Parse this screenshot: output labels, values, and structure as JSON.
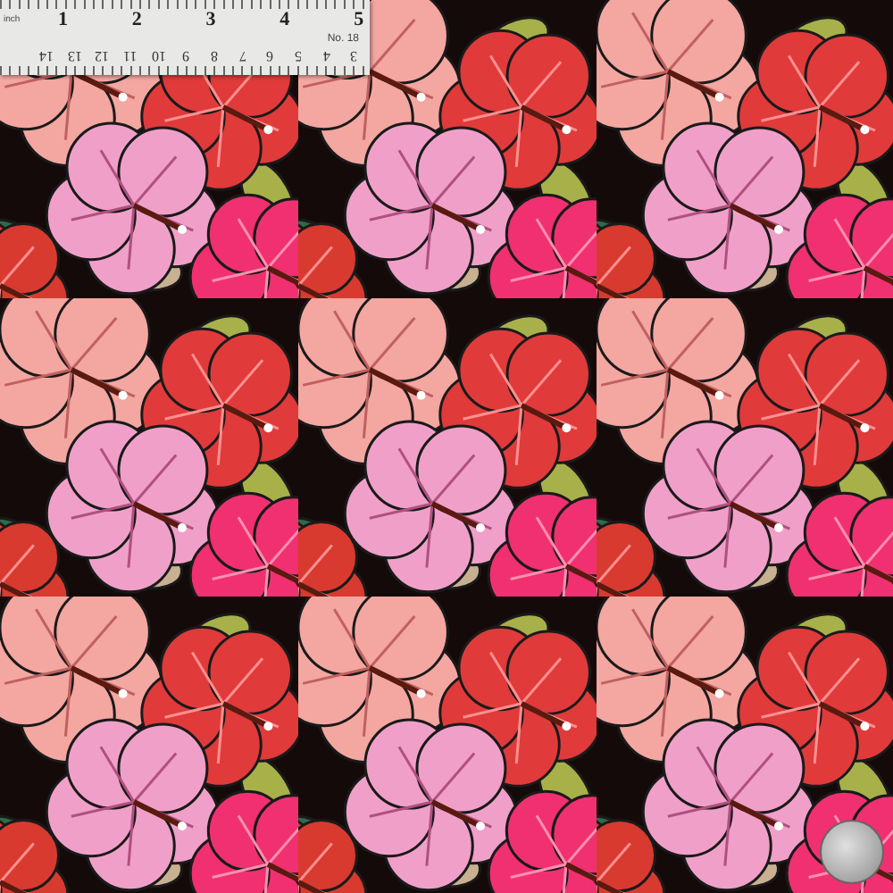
{
  "ruler": {
    "unit_label": "inch",
    "inch_marks": [
      "1",
      "2",
      "3",
      "4",
      "5"
    ],
    "model": "No. 18",
    "cm_marks": [
      "14",
      "13",
      "12",
      "11",
      "10",
      "9",
      "8",
      "7",
      "6",
      "5",
      "4",
      "3"
    ]
  }
}
